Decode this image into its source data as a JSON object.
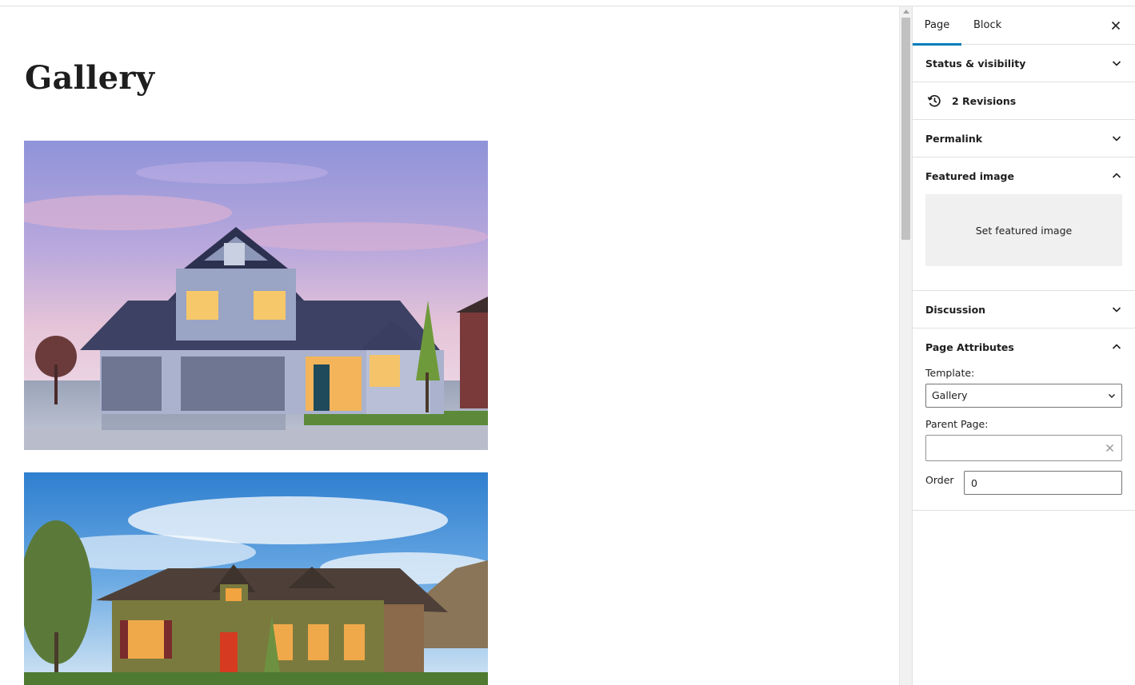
{
  "editor": {
    "title": "Gallery",
    "images": [
      {
        "subject": "two-story blue-gray house with garage at dusk"
      },
      {
        "subject": "single-story olive-green house with red door under blue sky"
      }
    ]
  },
  "sidebar": {
    "tabs": [
      {
        "label": "Page",
        "active": true
      },
      {
        "label": "Block",
        "active": false
      }
    ],
    "close_icon": "close-icon",
    "panels": {
      "status": {
        "label": "Status & visibility"
      },
      "revisions": {
        "label": "2 Revisions"
      },
      "permalink": {
        "label": "Permalink"
      },
      "featured": {
        "label": "Featured image",
        "button": "Set featured image"
      },
      "discussion": {
        "label": "Discussion"
      },
      "attributes": {
        "label": "Page Attributes",
        "template_label": "Template:",
        "template_value": "Gallery",
        "parent_label": "Parent Page:",
        "parent_value": "",
        "order_label": "Order",
        "order_value": "0"
      }
    }
  },
  "colors": {
    "accent": "#007cba",
    "panel_bg": "#f0f0f0",
    "border": "#e0e0e0"
  }
}
